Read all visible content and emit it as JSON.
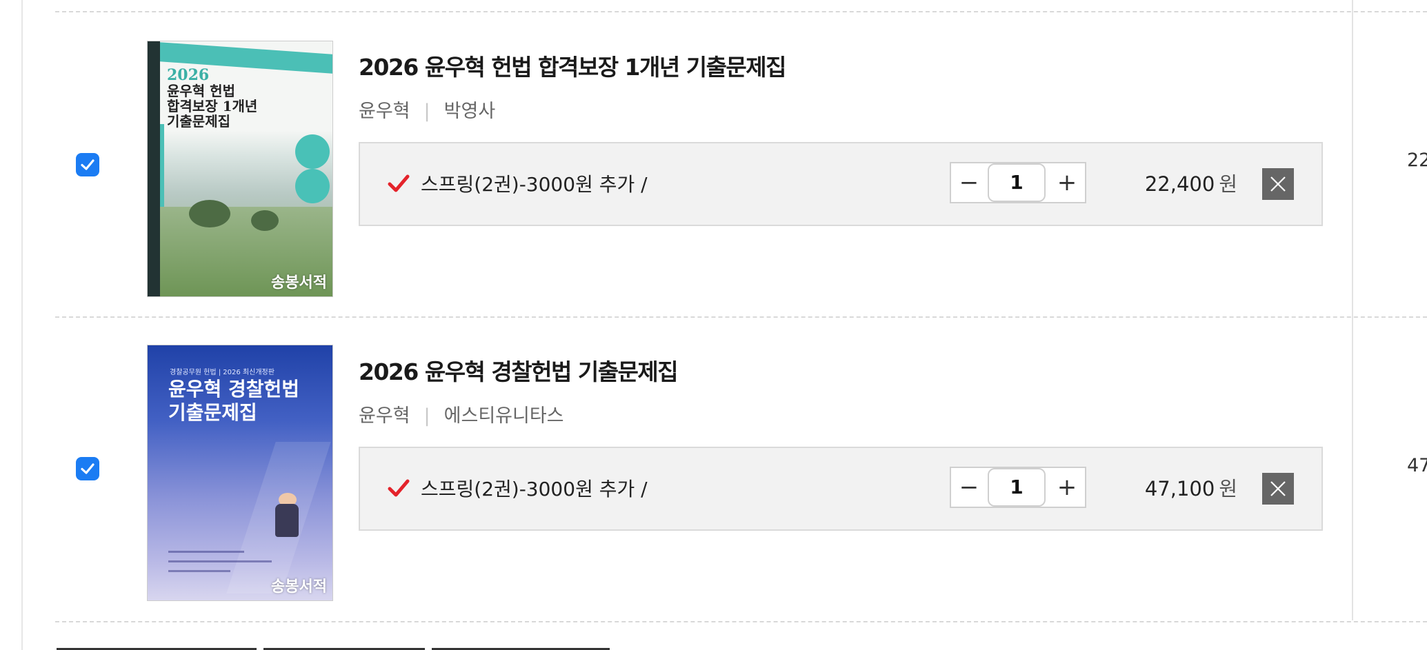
{
  "items": [
    {
      "checked": true,
      "title": "2026 윤우혁 헌법 합격보장 1개년 기출문제집",
      "author": "윤우혁",
      "publisher": "박영사",
      "cover": {
        "year": "2026",
        "title_lines": [
          "윤우혁 헌법",
          "합격보장 1개년",
          "기출문제집"
        ],
        "mark": "송봉서적"
      },
      "option": "스프링(2권)-3000원 추가 /",
      "quantity": "1",
      "price": "22,400",
      "currency": "원",
      "edge_price": "22"
    },
    {
      "checked": true,
      "title": "2026 윤우혁 경찰헌법 기출문제집",
      "author": "윤우혁",
      "publisher": "에스티유니타스",
      "cover": {
        "top_text": "경찰공무원 헌법 | 2026 최신개정판",
        "title_lines": [
          "윤우혁 경찰헌법",
          "기출문제집"
        ],
        "mark": "송봉서적"
      },
      "option": "스프링(2권)-3000원 추가 /",
      "quantity": "1",
      "price": "47,100",
      "currency": "원",
      "edge_price": "47"
    }
  ],
  "icons": {
    "checkbox": "check-icon",
    "option_check": "red-check-icon",
    "minus": "−",
    "plus": "+",
    "remove": "close-icon"
  },
  "colors": {
    "checkbox": "#1b7cf3",
    "option_check": "#e4232b",
    "option_bg": "#f2f2f2",
    "remove_btn": "#666666"
  }
}
